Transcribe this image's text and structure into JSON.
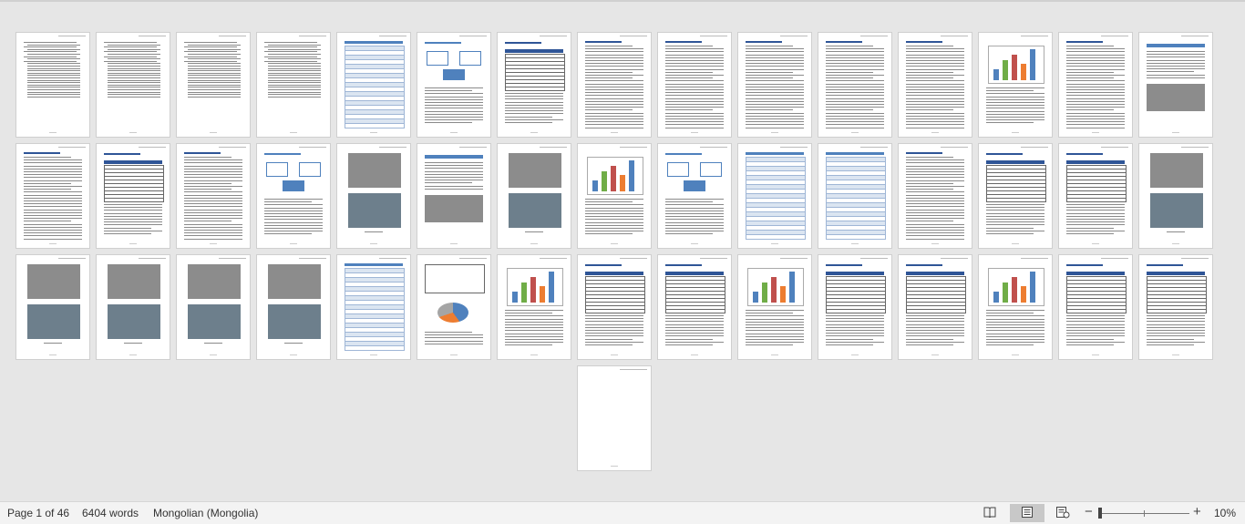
{
  "document": {
    "page_count": 46,
    "pages_per_row": 15
  },
  "statusbar": {
    "page_info": "Page 1 of 46",
    "word_count": "6404 words",
    "language": "Mongolian (Mongolia)",
    "zoom_level": "10%",
    "zoom_fraction": 0.1
  },
  "view_buttons": {
    "read_mode": "read-mode-icon",
    "print_layout": "print-layout-icon",
    "web_layout": "web-layout-icon",
    "active": "print_layout"
  },
  "colors": {
    "accent_blue": "#4f81bd",
    "header_blue": "#2f5597",
    "bar_orange": "#ed7d31",
    "bar_green": "#70ad47",
    "bar_red": "#c0504d",
    "photo_gray": "#8c8c8c"
  }
}
